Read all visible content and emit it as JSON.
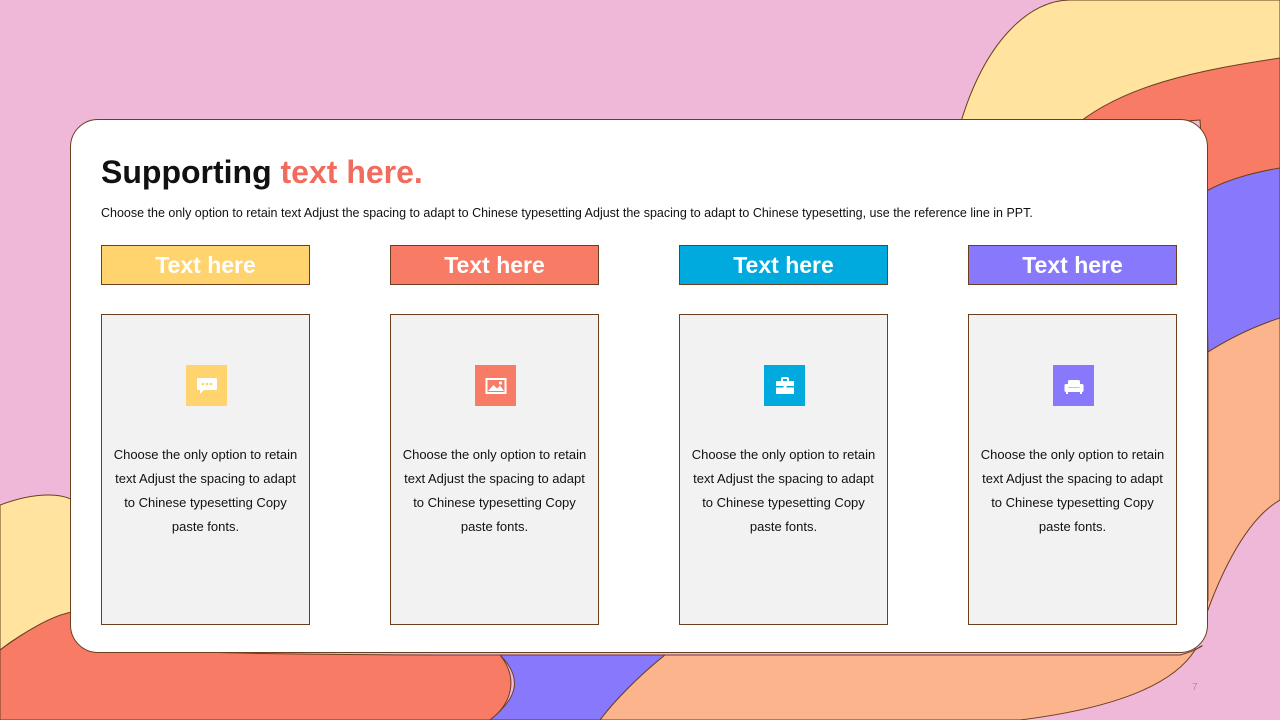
{
  "slide": {
    "title_main": "Supporting",
    "title_accent": "text here.",
    "subtitle": "Choose the only option to retain text Adjust the spacing to adapt to Chinese  typesetting Adjust the spacing to adapt to Chinese  typesetting, use the reference line  in  PPT.",
    "page_number": "7"
  },
  "colors": {
    "background_pink": "#f0b8d8",
    "yellow": "#ffd36e",
    "coral": "#f87b66",
    "blue": "#00a9de",
    "purple": "#8778fc",
    "peach": "#fcb48c",
    "border_brown": "#6b3e1f"
  },
  "columns": [
    {
      "header": "Text here",
      "color": "#ffd36e",
      "icon": "chat-bubble-icon",
      "body": "Choose the only option to retain text Adjust the spacing to adapt to Chinese  typesetting Copy paste fonts."
    },
    {
      "header": "Text here",
      "color": "#f87b66",
      "icon": "image-icon",
      "body": "Choose the only option to retain text Adjust the spacing to adapt to Chinese  typesetting Copy paste fonts."
    },
    {
      "header": "Text here",
      "color": "#00a9de",
      "icon": "briefcase-icon",
      "body": "Choose the only option to retain text Adjust the spacing to adapt to Chinese  typesetting Copy paste fonts."
    },
    {
      "header": "Text here",
      "color": "#8778fc",
      "icon": "sofa-icon",
      "body": "Choose the only option to retain text Adjust the spacing to adapt to Chinese  typesetting Copy paste fonts."
    }
  ]
}
